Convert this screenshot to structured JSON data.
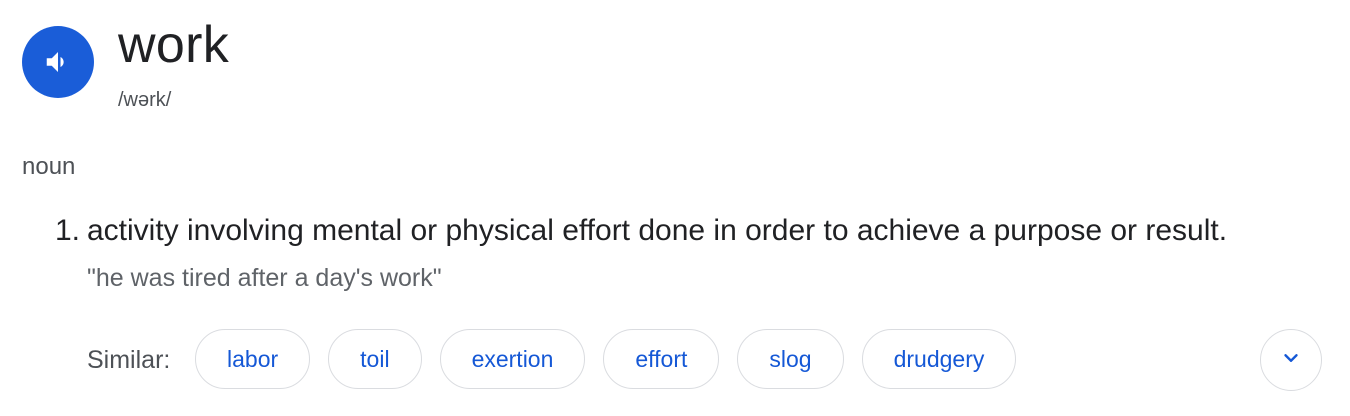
{
  "entry": {
    "word": "work",
    "phonetic": "/wərk/",
    "part_of_speech": "noun",
    "speak_icon": "speaker-icon"
  },
  "definitions": [
    {
      "number": "1.",
      "text": "activity involving mental or physical effort done in order to achieve a purpose or result.",
      "example": "\"he was tired after a day's work\""
    }
  ],
  "similar": {
    "label": "Similar:",
    "words": [
      "labor",
      "toil",
      "exertion",
      "effort",
      "slog",
      "drudgery"
    ]
  },
  "expand_icon": "chevron-down-icon",
  "colors": {
    "accent": "#1a5dd8",
    "link": "#1558d6",
    "chip_border": "#dadce0",
    "secondary_text": "#4d5156"
  }
}
